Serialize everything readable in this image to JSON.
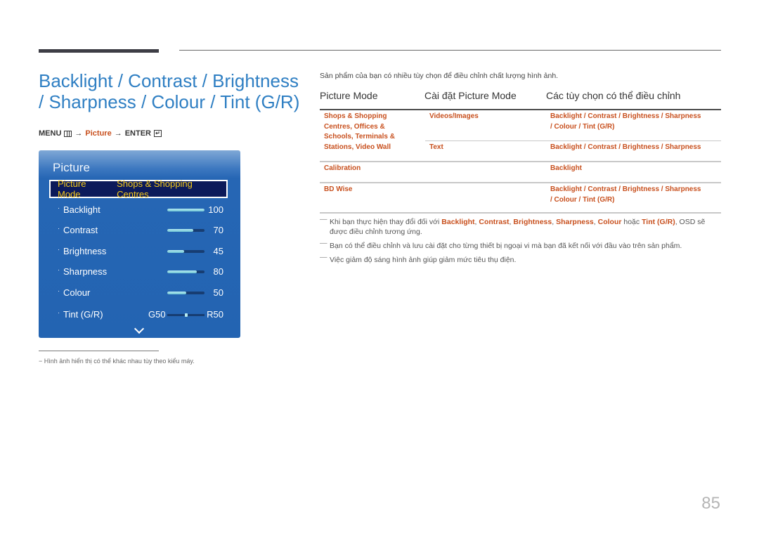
{
  "title": "Backlight / Contrast / Brightness / Sharpness / Colour / Tint (G/R)",
  "menu_path": {
    "menu": "MENU",
    "menu_icon": "menu-grid-icon",
    "arrow1": "→",
    "picture": "Picture",
    "arrow2": "→",
    "enter": "ENTER",
    "enter_icon": "enter-return-icon"
  },
  "osd": {
    "title": "Picture",
    "mode_label": "Picture Mode",
    "mode_value": "Shops & Shopping Centres",
    "items": [
      {
        "label": "Backlight",
        "value": "100",
        "percent": 100
      },
      {
        "label": "Contrast",
        "value": "70",
        "percent": 70
      },
      {
        "label": "Brightness",
        "value": "45",
        "percent": 45
      },
      {
        "label": "Sharpness",
        "value": "80",
        "percent": 80
      },
      {
        "label": "Colour",
        "value": "50",
        "percent": 50
      }
    ],
    "tint": {
      "label": "Tint (G/R)",
      "left": "G50",
      "right": "R50",
      "position_percent": 50
    },
    "more_icon": "chevron-down-icon"
  },
  "footnote": "−  Hình ảnh hiển thị có thể khác nhau tùy theo kiểu máy.",
  "intro": "Sản phẩm của bạn có nhiều tùy chọn để điều chỉnh chất lượng hình ảnh.",
  "table": {
    "headers": [
      "Picture Mode",
      "Cài đặt Picture Mode",
      "Các tùy chọn có thể điều chỉnh"
    ],
    "rows": [
      {
        "mode": "Shops & Shopping Centres, Offices & Schools, Terminals & Stations, Video Wall",
        "mode_lines": [
          "Shops & Shopping",
          "Centres, Offices &",
          "Schools, Terminals &",
          "Stations, Video Wall"
        ],
        "setting": "Videos/Images",
        "options_lines": [
          "Backlight / Contrast / Brightness / Sharpness",
          "/ Colour / Tint (G/R)"
        ]
      },
      {
        "mode": "",
        "setting": "Text",
        "options_lines": [
          "Backlight / Contrast / Brightness / Sharpness"
        ]
      },
      {
        "mode": "Calibration",
        "setting": "",
        "options_lines": [
          "Backlight"
        ]
      },
      {
        "mode": "BD Wise",
        "setting": "",
        "options_lines": [
          "Backlight / Contrast / Brightness / Sharpness",
          "/ Colour / Tint (G/R)"
        ]
      }
    ]
  },
  "notes": [
    {
      "parts": [
        {
          "t": "Khi bạn thực hiện thay đổi đối với ",
          "b": false
        },
        {
          "t": "Backlight",
          "b": true
        },
        {
          "t": ", ",
          "b": false
        },
        {
          "t": "Contrast",
          "b": true
        },
        {
          "t": ", ",
          "b": false
        },
        {
          "t": "Brightness",
          "b": true
        },
        {
          "t": ", ",
          "b": false
        },
        {
          "t": "Sharpness",
          "b": true
        },
        {
          "t": ", ",
          "b": false
        },
        {
          "t": "Colour",
          "b": true
        },
        {
          "t": " hoặc ",
          "b": false
        },
        {
          "t": "Tint (G/R)",
          "b": true
        },
        {
          "t": ", OSD sẽ được điều chỉnh tương ứng.",
          "b": false
        }
      ]
    },
    {
      "parts": [
        {
          "t": "Bạn có thể điều chỉnh và lưu cài đặt cho từng thiết bị ngoại vi mà bạn đã kết nối với đầu vào trên sản phẩm.",
          "b": false
        }
      ]
    },
    {
      "parts": [
        {
          "t": "Việc giảm độ sáng hình ảnh giúp giảm mức tiêu thụ điện.",
          "b": false
        }
      ]
    }
  ],
  "note_dash": "—",
  "page_number": "85",
  "colors": {
    "accent_orange": "#c8501e",
    "title_blue": "#2f7fc3",
    "osd_blue": "#2364b2",
    "osd_mode_text": "#f3c81a"
  }
}
